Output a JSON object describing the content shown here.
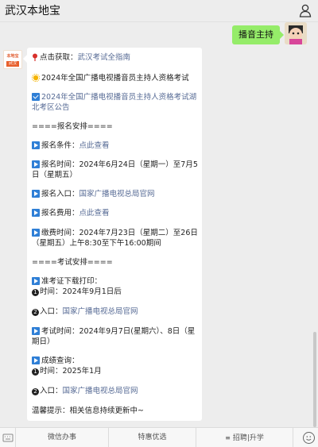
{
  "header": {
    "title": "武汉本地宝"
  },
  "outgoing": {
    "text": "播音主持"
  },
  "bot": {
    "avatar_top": "本地宝",
    "avatar_tag": "武汉"
  },
  "message": {
    "l1_prefix": "点击获取：",
    "l1_link": "武汉考试全指南",
    "l2": "2024年全国广播电视播音员主持人资格考试",
    "l3_link": "2024年全国广播电视播音员主持人资格考试湖北考区公告",
    "l4": "====报名安排====",
    "l5_prefix": "报名条件：",
    "l5_link": "点此查看",
    "l6": "报名时间：2024年6月24日（星期一）至7月5日（星期五）",
    "l7_prefix": "报名入口：",
    "l7_link": "国家广播电视总局官网",
    "l8_prefix": "报名费用：",
    "l8_link": "点此查看",
    "l9": "缴费时间：2024年7月23日（星期二）至26日（星期五）上午8:30至下午16:00期间",
    "l10": "====考试安排====",
    "l11": "准考证下载打印：",
    "l12": "时间：2024年9月1日后",
    "l13_prefix": "入口：",
    "l13_link": "国家广播电视总局官网",
    "l14": "考试时间：2024年9月7日(星期六）、8日（星期日）",
    "l15": "成绩查询：",
    "l16": "时间：2025年1月",
    "l17_prefix": "入口：",
    "l17_link": "国家广播电视总局官网",
    "l18": "温馨提示：相关信息持续更新中~",
    "num1": "1",
    "num2": "2"
  },
  "menu": {
    "item1": "微信办事",
    "item2": "特惠优选",
    "item3": "招聘|升学"
  },
  "icons": {
    "user": "user-icon",
    "keyboard": "keyboard-icon",
    "emoji": "emoji-icon",
    "play": "play-icon",
    "check": "check-icon",
    "pin": "pin-icon",
    "sun": "sun-icon"
  },
  "colors": {
    "link": "#576b95",
    "bubble_out": "#95ec69",
    "accent_blue": "#2f7fd6"
  }
}
